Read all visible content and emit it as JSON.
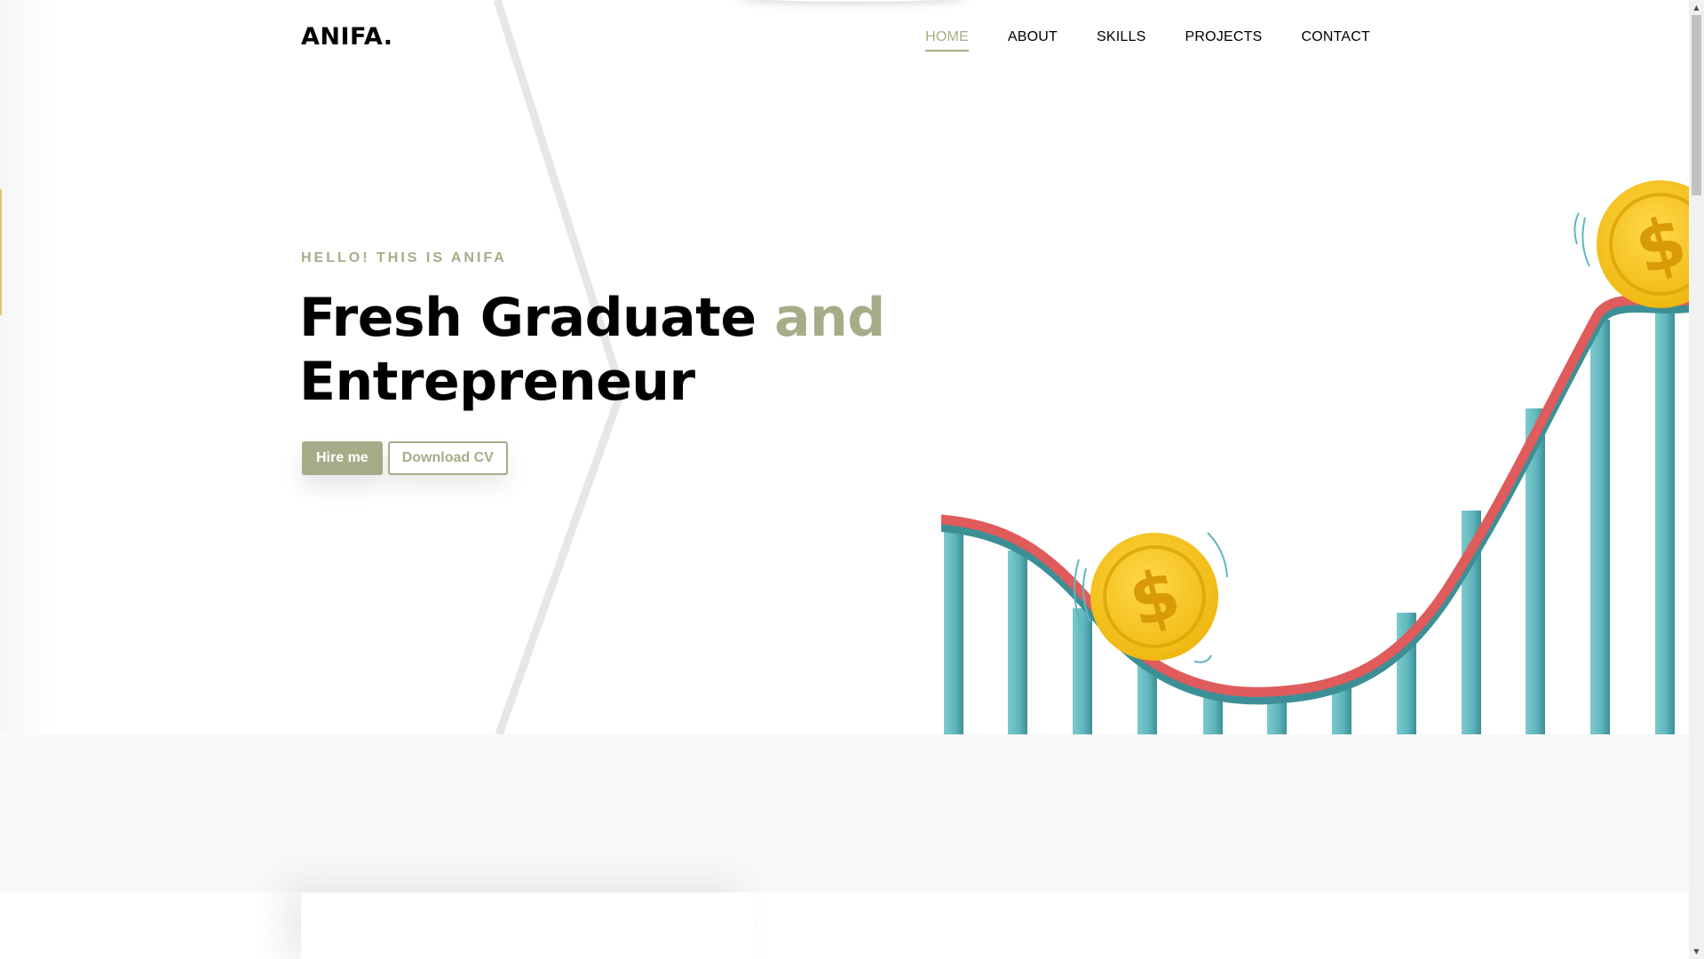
{
  "brand": {
    "logo": "ANIFA."
  },
  "nav": {
    "items": [
      "HOME",
      "ABOUT",
      "SKILLS",
      "PROJECTS",
      "CONTACT"
    ],
    "active": "HOME"
  },
  "hero": {
    "greeting": "HELLO! THIS IS ANIFA",
    "headline_part1": "Fresh Graduate",
    "headline_accent": "and",
    "headline_part2": "Entrepreneur",
    "buttons": {
      "hire": "Hire me",
      "download": "Download CV"
    }
  },
  "colors": {
    "accent": "#a8ab88",
    "coin": "#f2c11c",
    "track": "#e05b5b",
    "pillar": "#5fb7bd",
    "band": "#f7f8fa"
  },
  "icons": {
    "illustration": "coins-rollercoaster-illustration",
    "scroll_up": "scroll-up-arrow-icon",
    "scroll_down": "scroll-down-arrow-icon"
  }
}
